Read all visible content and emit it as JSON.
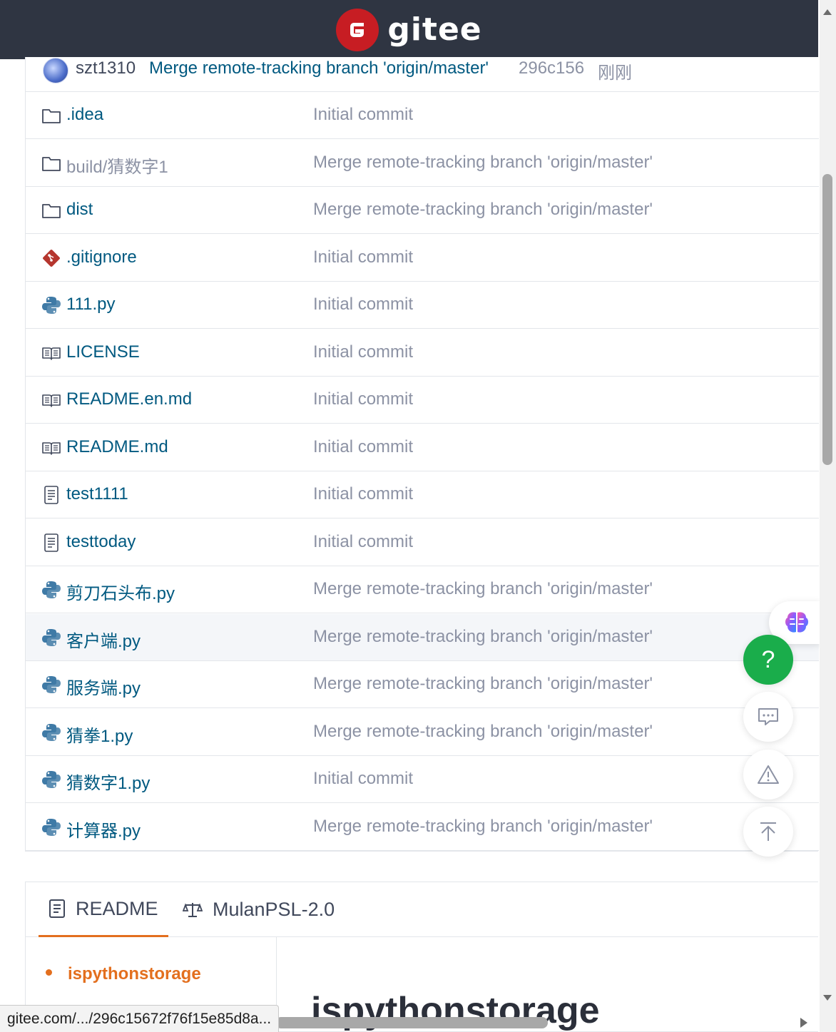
{
  "header": {
    "logo_text": "gitee",
    "logo_letter": "G"
  },
  "commit_bar": {
    "user": "szt1310",
    "message": "Merge remote-tracking branch 'origin/master'",
    "sha": "296c156",
    "time": "刚刚"
  },
  "files": [
    {
      "name": ".idea",
      "type": "folder",
      "message": "Initial commit"
    },
    {
      "name": "build/猜数字1",
      "type": "folder",
      "message": "Merge remote-tracking branch 'origin/master'"
    },
    {
      "name": "dist",
      "type": "folder",
      "message": "Merge remote-tracking branch 'origin/master'"
    },
    {
      "name": ".gitignore",
      "type": "git",
      "message": "Initial commit"
    },
    {
      "name": "111.py",
      "type": "python",
      "message": "Initial commit"
    },
    {
      "name": "LICENSE",
      "type": "book",
      "message": "Initial commit"
    },
    {
      "name": "README.en.md",
      "type": "book",
      "message": "Initial commit"
    },
    {
      "name": "README.md",
      "type": "book",
      "message": "Initial commit"
    },
    {
      "name": "test1111",
      "type": "doc",
      "message": "Initial commit"
    },
    {
      "name": "testtoday",
      "type": "doc",
      "message": "Initial commit"
    },
    {
      "name": "剪刀石头布.py",
      "type": "python",
      "message": "Merge remote-tracking branch 'origin/master'"
    },
    {
      "name": "客户端.py",
      "type": "python",
      "message": "Merge remote-tracking branch 'origin/master'"
    },
    {
      "name": "服务端.py",
      "type": "python",
      "message": "Merge remote-tracking branch 'origin/master'"
    },
    {
      "name": "猜拳1.py",
      "type": "python",
      "message": "Merge remote-tracking branch 'origin/master'"
    },
    {
      "name": "猜数字1.py",
      "type": "python",
      "message": "Initial commit"
    },
    {
      "name": "计算器.py",
      "type": "python",
      "message": "Merge remote-tracking branch 'origin/master'"
    }
  ],
  "readme": {
    "tabs": [
      {
        "label": "README",
        "icon": "document-icon"
      },
      {
        "label": "MulanPSL-2.0",
        "icon": "scale-icon"
      }
    ],
    "toc": [
      "ispythonstorage"
    ],
    "heading": "ispythonstorage"
  },
  "floating": {
    "help_label": "?"
  },
  "status_url": "gitee.com/.../296c15672f76f15e85d8a...",
  "colors": {
    "header_bg": "#2f3542",
    "link": "#005980",
    "accent": "#e36f1e",
    "help_green": "#1aad4b",
    "brand_red": "#c71d23"
  }
}
